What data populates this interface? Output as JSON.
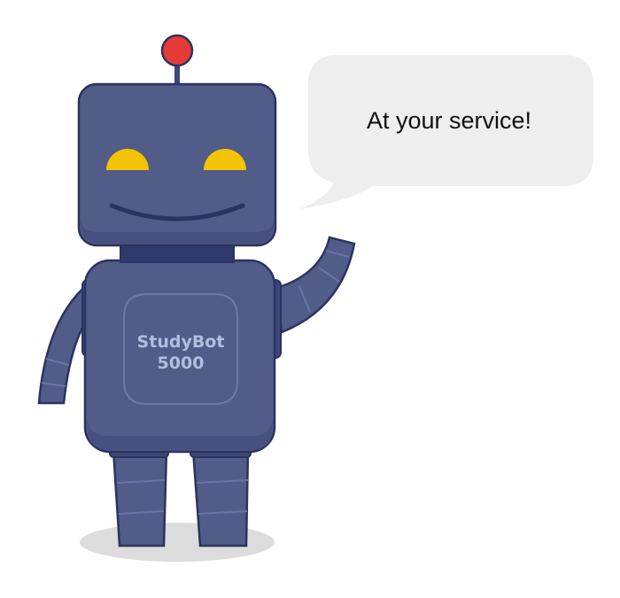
{
  "speech_bubble": {
    "text": "At your service!"
  },
  "robot": {
    "chest_label_line1": "StudyBot",
    "chest_label_line2": "5000"
  },
  "colors": {
    "body": "#525c89",
    "body_dark": "#3e4877",
    "outline": "#2b3361",
    "eyes": "#f5c400",
    "antenna_ball": "#e53a37",
    "bubble": "#eeeeee",
    "shadow": "#dcdcdc"
  }
}
